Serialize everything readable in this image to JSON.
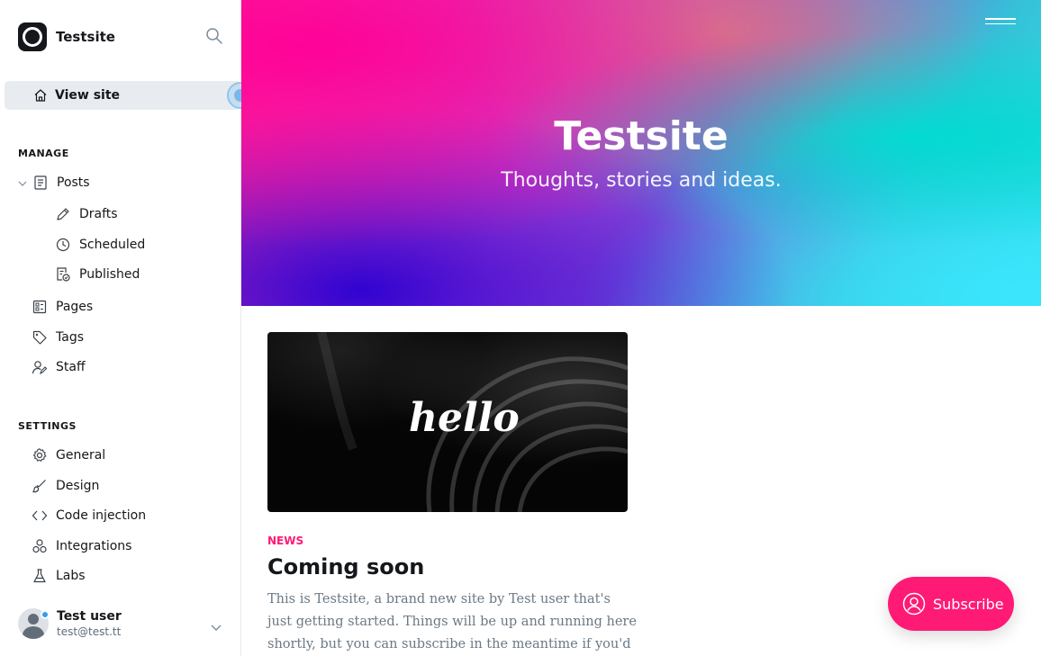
{
  "sidebar": {
    "brand_name": "Testsite",
    "view_site": "View site",
    "manage_title": "MANAGE",
    "posts": "Posts",
    "drafts": "Drafts",
    "scheduled": "Scheduled",
    "published": "Published",
    "pages": "Pages",
    "tags": "Tags",
    "staff": "Staff",
    "settings_title": "SETTINGS",
    "general": "General",
    "design": "Design",
    "code_injection": "Code injection",
    "integrations": "Integrations",
    "labs": "Labs",
    "user": {
      "name": "Test user",
      "email": "test@test.tt"
    }
  },
  "hero": {
    "title": "Testsite",
    "subtitle": "Thoughts, stories and ideas."
  },
  "post": {
    "image_text": "hello",
    "tag": "NEWS",
    "title": "Coming soon",
    "excerpt": "This is Testsite, a brand new site by Test user that's just getting started. Things will be up and running here shortly, but you can subscribe in the meantime if you'd like to stay up t…"
  },
  "subscribe_label": "Subscribe",
  "colors": {
    "accent": "#ff1a75",
    "active_bg": "#e8ecf0",
    "text": "#15171a"
  },
  "icons": [
    "search-icon",
    "home-icon",
    "posts-icon",
    "pencil-icon",
    "clock-icon",
    "published-icon",
    "pages-icon",
    "tag-icon",
    "staff-icon",
    "gear-icon",
    "brush-icon",
    "code-icon",
    "integrations-icon",
    "labs-icon",
    "menu-icon",
    "user-icon"
  ]
}
